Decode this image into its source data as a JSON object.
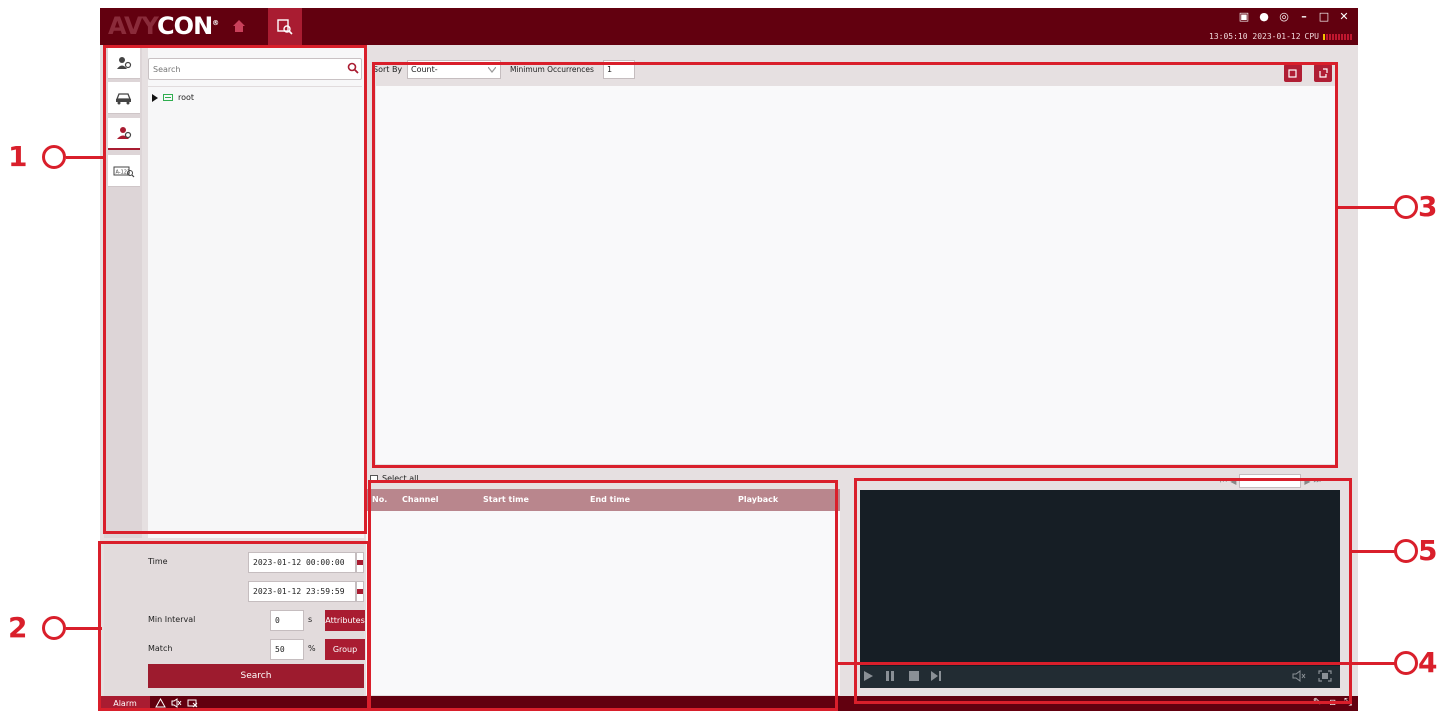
{
  "app": {
    "logo_prefix": "AVY",
    "logo_suffix": "CON",
    "trademark": "®",
    "clock": "13:05:10 2023-01-12",
    "cpu_label": "CPU",
    "cpu_level": 0.1
  },
  "sidebar": {
    "tabs": [
      {
        "icon": "person-search-icon"
      },
      {
        "icon": "vehicle-icon"
      },
      {
        "icon": "face-icon",
        "active": true
      },
      {
        "icon": "plate-search-icon"
      }
    ]
  },
  "tree": {
    "search_placeholder": "Search",
    "root_label": "root"
  },
  "filters": {
    "time_label": "Time",
    "start_time": "2023-01-12 00:00:00",
    "end_time": "2023-01-12 23:59:59",
    "min_interval_label": "Min Interval",
    "min_interval_value": "0",
    "min_interval_unit": "s",
    "attributes_button": "Attributes",
    "match_label": "Match",
    "match_value": "50",
    "match_unit": "%",
    "group_button": "Group",
    "search_button": "Search"
  },
  "main": {
    "sort_by_label": "Sort By",
    "sort_by_value": "Count-",
    "min_occurrences_label": "Minimum Occurrences",
    "min_occurrences_value": "1"
  },
  "results": {
    "select_all_label": "Select all",
    "columns": [
      "No.",
      "Channel",
      "Start time",
      "End time",
      "Playback"
    ]
  },
  "bottombar": {
    "alarm_label": "Alarm"
  },
  "annotations": [
    {
      "number": "1"
    },
    {
      "number": "2"
    },
    {
      "number": "3"
    },
    {
      "number": "4"
    },
    {
      "number": "5"
    }
  ],
  "colors": {
    "brand_dark": "#62000f",
    "brand_accent": "#a91c31",
    "annotation_red": "#d91f2b"
  }
}
